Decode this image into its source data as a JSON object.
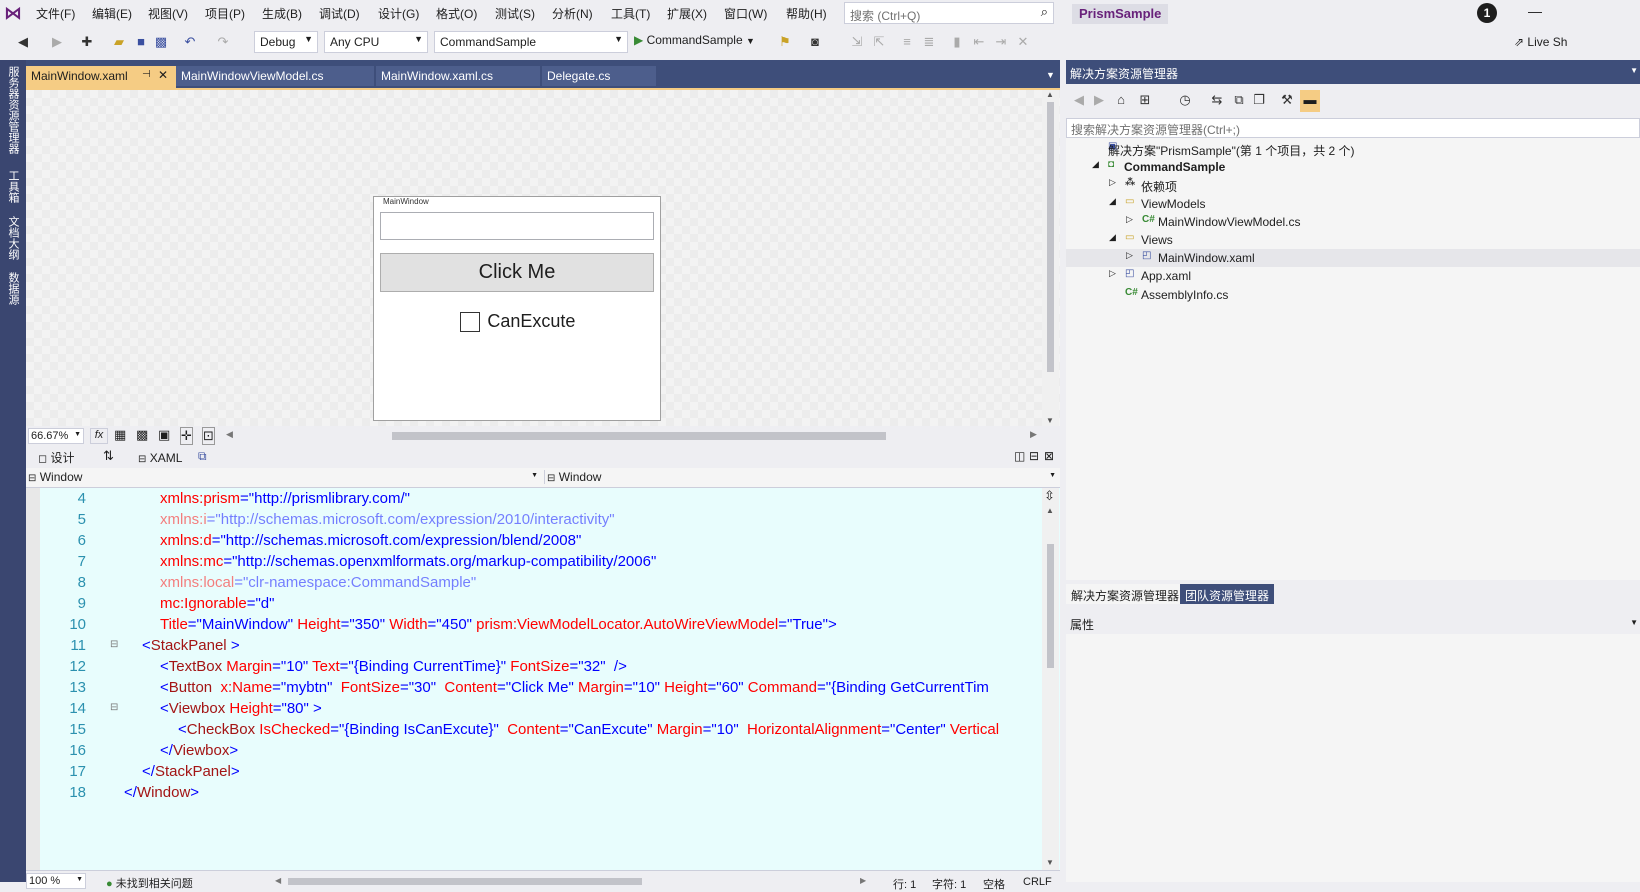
{
  "menu": [
    "文件(F)",
    "编辑(E)",
    "视图(V)",
    "项目(P)",
    "生成(B)",
    "调试(D)",
    "设计(G)",
    "格式(O)",
    "测试(S)",
    "分析(N)",
    "工具(T)",
    "扩展(X)",
    "窗口(W)",
    "帮助(H)"
  ],
  "search": {
    "placeholder": "搜索 (Ctrl+Q)"
  },
  "app_title": "PrismSample",
  "notification_count": "1",
  "toolbar": {
    "config": "Debug",
    "platform": "Any CPU",
    "startup": "CommandSample",
    "run_label": "CommandSample",
    "live_share": "Live Sh"
  },
  "left_tools": [
    "服务器资源管理器",
    "工具箱",
    "文档大纲",
    "数据源"
  ],
  "tabs": [
    "MainWindow.xaml",
    "MainWindowViewModel.cs",
    "MainWindow.xaml.cs",
    "Delegate.cs"
  ],
  "preview": {
    "window_title": "MainWindow",
    "button": "Click Me",
    "checkbox": "CanExcute"
  },
  "design_bar": {
    "zoom": "66.67%",
    "fx": "fx"
  },
  "split": {
    "design": "设计",
    "xaml": "XAML"
  },
  "nav": {
    "left": "Window",
    "right": "Window"
  },
  "code_lines": [
    {
      "n": "4",
      "parts": [
        [
          "attr",
          "xmlns:prism"
        ],
        [
          "br",
          "=\"http://prismlibrary.com/\""
        ]
      ],
      "indent": 2
    },
    {
      "n": "5",
      "parts": [
        [
          "attr",
          "xmlns:i"
        ],
        [
          "br",
          "=\"http://schemas.microsoft.com/expression/2010/interactivity\""
        ]
      ],
      "indent": 2,
      "dim": true
    },
    {
      "n": "6",
      "parts": [
        [
          "attr",
          "xmlns:d"
        ],
        [
          "br",
          "=\"http://schemas.microsoft.com/expression/blend/2008\""
        ]
      ],
      "indent": 2
    },
    {
      "n": "7",
      "parts": [
        [
          "attr",
          "xmlns:mc"
        ],
        [
          "br",
          "=\"http://schemas.openxmlformats.org/markup-compatibility/2006\""
        ]
      ],
      "indent": 2
    },
    {
      "n": "8",
      "parts": [
        [
          "attr",
          "xmlns:local"
        ],
        [
          "br",
          "=\"clr-namespace:CommandSample\""
        ]
      ],
      "indent": 2,
      "dim": true
    },
    {
      "n": "9",
      "parts": [
        [
          "attr",
          "mc:Ignorable"
        ],
        [
          "br",
          "=\"d\""
        ]
      ],
      "indent": 2
    },
    {
      "n": "10",
      "parts": [
        [
          "attr",
          "Title"
        ],
        [
          "br",
          "=\"MainWindow\" "
        ],
        [
          "attr",
          "Height"
        ],
        [
          "br",
          "=\"350\" "
        ],
        [
          "attr",
          "Width"
        ],
        [
          "br",
          "=\"450\" "
        ],
        [
          "attr",
          "prism:ViewModelLocator.AutoWireViewModel"
        ],
        [
          "br",
          "=\"True\">"
        ]
      ],
      "indent": 2
    },
    {
      "n": "11",
      "parts": [
        [
          "br",
          "<"
        ],
        [
          "tag",
          "StackPanel"
        ],
        [
          "br",
          " >"
        ]
      ],
      "indent": 1
    },
    {
      "n": "12",
      "parts": [
        [
          "br",
          "<"
        ],
        [
          "tag",
          "TextBox"
        ],
        [
          "attr",
          " Margin"
        ],
        [
          "br",
          "=\"10\" "
        ],
        [
          "attr",
          "Text"
        ],
        [
          "br",
          "=\"{Binding CurrentTime}\" "
        ],
        [
          "attr",
          "FontSize"
        ],
        [
          "br",
          "=\"32\"  />"
        ]
      ],
      "indent": 2
    },
    {
      "n": "13",
      "parts": [
        [
          "br",
          "<"
        ],
        [
          "tag",
          "Button"
        ],
        [
          "attr",
          "  x:Name"
        ],
        [
          "br",
          "=\"mybtn\"  "
        ],
        [
          "attr",
          "FontSize"
        ],
        [
          "br",
          "=\"30\"  "
        ],
        [
          "attr",
          "Content"
        ],
        [
          "br",
          "=\"Click Me\" "
        ],
        [
          "attr",
          "Margin"
        ],
        [
          "br",
          "=\"10\" "
        ],
        [
          "attr",
          "Height"
        ],
        [
          "br",
          "=\"60\" "
        ],
        [
          "attr",
          "Command"
        ],
        [
          "br",
          "=\"{Binding GetCurrentTim"
        ]
      ],
      "indent": 2
    },
    {
      "n": "14",
      "parts": [
        [
          "br",
          "<"
        ],
        [
          "tag",
          "Viewbox"
        ],
        [
          "attr",
          " Height"
        ],
        [
          "br",
          "=\"80\" >"
        ]
      ],
      "indent": 2
    },
    {
      "n": "15",
      "parts": [
        [
          "br",
          "<"
        ],
        [
          "tag",
          "CheckBox"
        ],
        [
          "attr",
          " IsChecked"
        ],
        [
          "br",
          "=\"{Binding IsCanExcute}\"  "
        ],
        [
          "attr",
          "Content"
        ],
        [
          "br",
          "=\"CanExcute\" "
        ],
        [
          "attr",
          "Margin"
        ],
        [
          "br",
          "=\"10\"  "
        ],
        [
          "attr",
          "HorizontalAlignment"
        ],
        [
          "br",
          "=\"Center\" "
        ],
        [
          "attr",
          "Vertical"
        ]
      ],
      "indent": 3
    },
    {
      "n": "16",
      "parts": [
        [
          "br",
          "</"
        ],
        [
          "tag",
          "Viewbox"
        ],
        [
          "br",
          ">"
        ]
      ],
      "indent": 2
    },
    {
      "n": "17",
      "parts": [
        [
          "br",
          "</"
        ],
        [
          "tag",
          "StackPanel"
        ],
        [
          "br",
          ">"
        ]
      ],
      "indent": 1
    },
    {
      "n": "18",
      "parts": [
        [
          "br",
          "</"
        ],
        [
          "tag",
          "Window"
        ],
        [
          "br",
          ">"
        ]
      ],
      "indent": 0
    }
  ],
  "status": {
    "zoom": "100 %",
    "issues": "未找到相关问题",
    "line": "行: 1",
    "char": "字符: 1",
    "space": "空格",
    "eol": "CRLF"
  },
  "solution": {
    "title": "解决方案资源管理器",
    "search": "搜索解决方案资源管理器(Ctrl+;)",
    "items": [
      {
        "label": "解决方案\"PrismSample\"(第 1 个项目，共 2 个)",
        "level": 0,
        "icon": "solution-icon",
        "expander": ""
      },
      {
        "label": "CommandSample",
        "level": 0,
        "icon": "csharp-project-icon",
        "expander": "◢",
        "bold": true
      },
      {
        "label": "依赖项",
        "level": 1,
        "icon": "dependencies-icon",
        "expander": "▷"
      },
      {
        "label": "ViewModels",
        "level": 1,
        "icon": "folder-icon",
        "expander": "◢"
      },
      {
        "label": "MainWindowViewModel.cs",
        "level": 2,
        "icon": "csharp-file-icon",
        "expander": "▷"
      },
      {
        "label": "Views",
        "level": 1,
        "icon": "folder-icon",
        "expander": "◢"
      },
      {
        "label": "MainWindow.xaml",
        "level": 2,
        "icon": "xaml-file-icon",
        "expander": "▷",
        "selected": true
      },
      {
        "label": "App.xaml",
        "level": 1,
        "icon": "xaml-file-icon",
        "expander": "▷"
      },
      {
        "label": "AssemblyInfo.cs",
        "level": 1,
        "icon": "csharp-file-icon",
        "expander": ""
      }
    ]
  },
  "panel_tabs": [
    "解决方案资源管理器",
    "团队资源管理器"
  ],
  "properties": {
    "title": "属性"
  }
}
